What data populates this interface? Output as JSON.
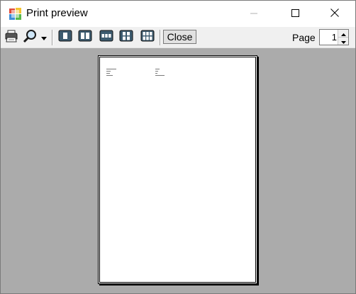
{
  "window": {
    "title": "Print preview"
  },
  "title_buttons": {
    "minimize_icon": "minimize-icon",
    "maximize_icon": "maximize-icon",
    "close_icon": "close-icon"
  },
  "toolbar": {
    "print_icon": "printer-icon",
    "zoom_icon": "magnifier-icon",
    "zoom_dropdown_icon": "dropdown-arrow-icon",
    "layouts": [
      "one-page-icon",
      "two-pages-icon",
      "three-pages-icon",
      "four-pages-icon",
      "six-pages-icon"
    ],
    "close_label": "Close",
    "page_label": "Page",
    "page_value": "1"
  },
  "colors": {
    "preview_background": "#ababab",
    "toolbar_background": "#f0f0f0",
    "layout_icon_fill": "#3c5a6e"
  }
}
